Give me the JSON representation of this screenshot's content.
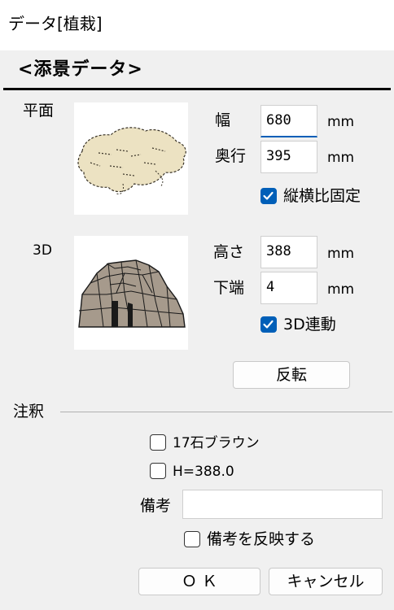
{
  "window": {
    "title": "データ[植栽]"
  },
  "section": {
    "heading": "<添景データ>"
  },
  "plan": {
    "label": "平面",
    "image_icon": "shrub-plan-view-icon",
    "width_label": "幅",
    "width_value": "680",
    "width_unit": "mm",
    "depth_label": "奥行",
    "depth_value": "395",
    "depth_unit": "mm",
    "aspect_lock_label": "縦横比固定",
    "aspect_lock_checked": true
  },
  "view3d": {
    "label": "3D",
    "image_icon": "rock-3d-view-icon",
    "height_label": "高さ",
    "height_value": "388",
    "height_unit": "mm",
    "bottom_label": "下端",
    "bottom_value": "4",
    "bottom_unit": "mm",
    "link_label": "3D連動",
    "link_checked": true,
    "flip_button": "反転"
  },
  "annotation": {
    "group_label": "注釈",
    "name_label": "17石ブラウン",
    "name_checked": false,
    "height_text": "H=388.0",
    "height_checked": false,
    "remarks_label": "備考",
    "remarks_value": "",
    "reflect_label": "備考を反映する",
    "reflect_checked": false
  },
  "buttons": {
    "ok": "Ｏ Ｋ",
    "cancel": "キャンセル"
  },
  "colors": {
    "accent": "#005fb8",
    "dialog_bg": "#f0f0f0",
    "titlebar_bg": "#ffffff"
  }
}
